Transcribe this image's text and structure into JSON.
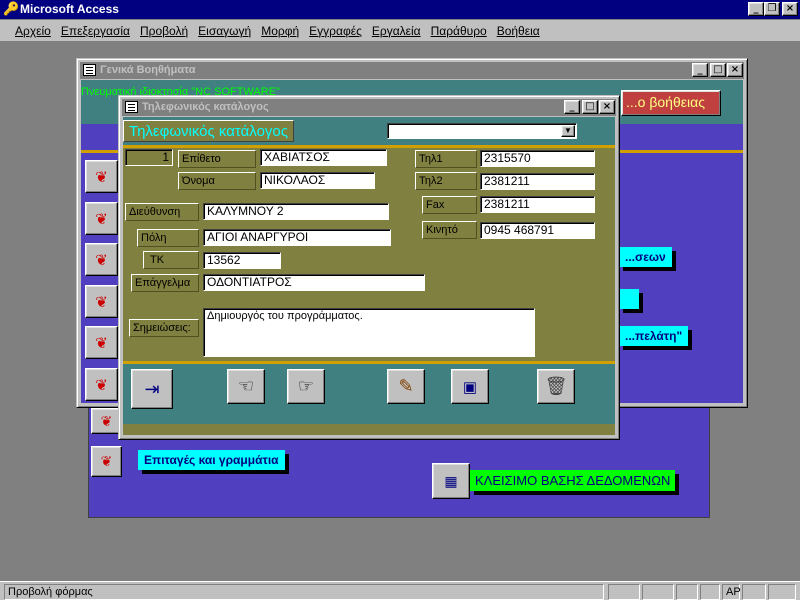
{
  "app": {
    "title": "Microsoft Access"
  },
  "menu": [
    "Αρχείο",
    "Επεξεργασία",
    "Προβολή",
    "Εισαγωγή",
    "Μορφή",
    "Εγγραφές",
    "Εργαλεία",
    "Παράθυρο",
    "Βοήθεια"
  ],
  "bg_form": {
    "cyan_1": "...σεων",
    "cyan_3": "...πελάτη\"",
    "cyan_bottom": "Επιταγές και γραμμάτια"
  },
  "helpers_window": {
    "title": "Γενικά Βοηθήματα",
    "marquee": "Πνευματική ιδιοκτησία \"NC SOFTWARE\"",
    "help_button": "...ο βοήθειας",
    "close_db_label": "ΚΛΕΙΣΙΜΟ ΒΑΣΗΣ ΔΕΔΟΜΕΝΩΝ"
  },
  "phone_window": {
    "title": "Τηλεφωνικός κατάλογος",
    "heading": "Τηλεφωνικός κατάλογος",
    "combo_value": "",
    "record_id": "1",
    "labels": {
      "surname": "Επίθετο",
      "name": "Όνομα",
      "address": "Διεύθυνση",
      "city": "Πόλη",
      "zip": "ΤΚ",
      "profession": "Επάγγελμα",
      "notes": "Σημειώσεις:",
      "tel1": "Τηλ1",
      "tel2": "Τηλ2",
      "fax": "Fax",
      "mobile": "Κινητό"
    },
    "values": {
      "surname": "ΧΑΒΙΑΤΣΟΣ",
      "name": "ΝΙΚΟΛΑΟΣ",
      "address": "ΚΑΛΥΜΝΟΥ 2",
      "city": "ΑΓΙΟΙ ΑΝΑΡΓΥΡΟΙ",
      "zip": "13562",
      "profession": "ΟΔΟΝΤΙΑΤΡΟΣ",
      "notes": "Δημιουργός του προγράμματος.",
      "tel1": "2315570",
      "tel2": "2381211",
      "fax": "2381211",
      "mobile": "0945 468791"
    }
  },
  "status": {
    "text": "Προβολή φόρμας",
    "ind": "ΑΡ"
  },
  "colors": {
    "form_bg": "#808040",
    "purple": "#5040c0",
    "teal": "#408080"
  }
}
